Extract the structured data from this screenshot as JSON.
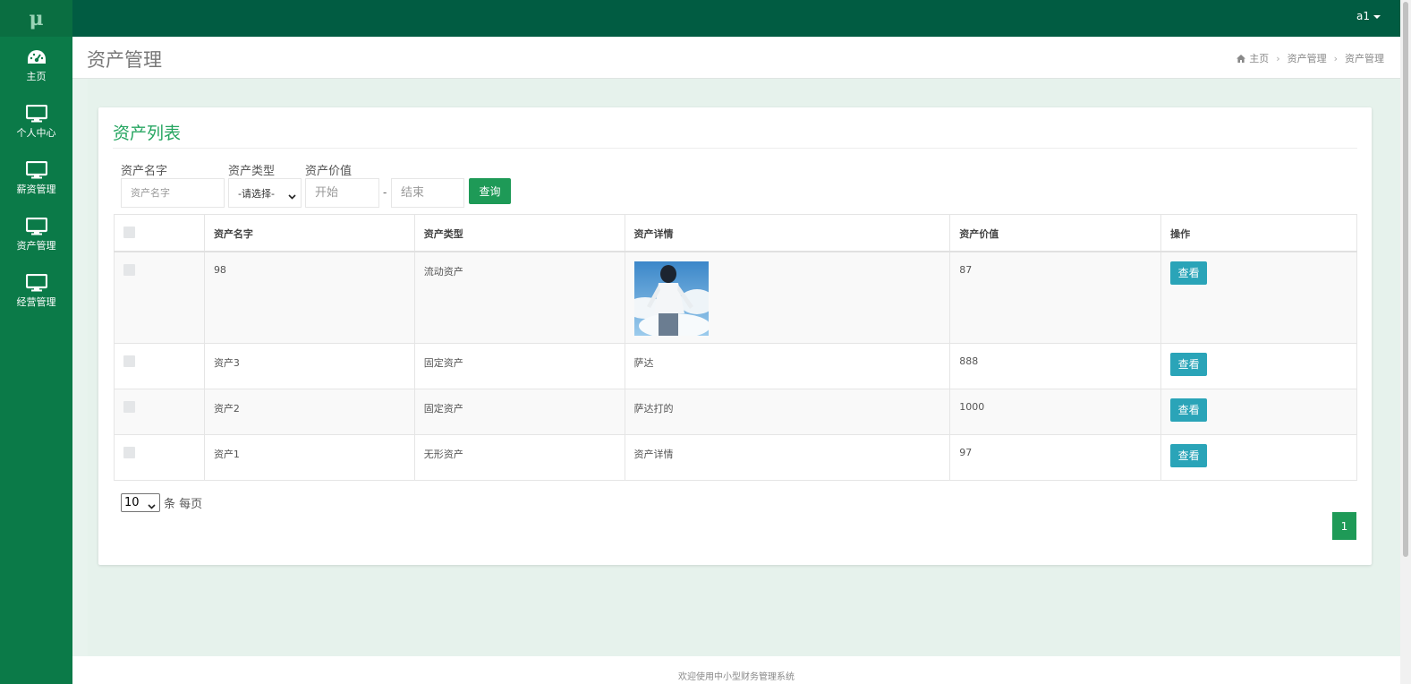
{
  "logo": {
    "text": "μ"
  },
  "sidebar": {
    "items": [
      {
        "label": "主页",
        "icon": "dashboard-icon"
      },
      {
        "label": "个人中心",
        "icon": "monitor-icon"
      },
      {
        "label": "薪资管理",
        "icon": "monitor-icon"
      },
      {
        "label": "资产管理",
        "icon": "monitor-icon"
      },
      {
        "label": "经营管理",
        "icon": "monitor-icon"
      }
    ]
  },
  "topbar": {
    "user": "a1"
  },
  "header": {
    "title": "资产管理",
    "breadcrumb": [
      "主页",
      "资产管理",
      "资产管理"
    ]
  },
  "box": {
    "title": "资产列表",
    "filters": {
      "name_label": "资产名字",
      "name_placeholder": "资产名字",
      "type_label": "资产类型",
      "type_selected": "-请选择-",
      "value_label": "资产价值",
      "start_placeholder": "开始",
      "dash": "-",
      "end_placeholder": "结束",
      "search_button": "查询"
    },
    "table": {
      "headers": [
        "资产名字",
        "资产类型",
        "资产详情",
        "资产价值",
        "操作"
      ],
      "rows": [
        {
          "name": "98",
          "type": "流动资产",
          "detail": "",
          "has_image": true,
          "value": "87",
          "action": "查看"
        },
        {
          "name": "资产3",
          "type": "固定资产",
          "detail": "萨达",
          "has_image": false,
          "value": "888",
          "action": "查看"
        },
        {
          "name": "资产2",
          "type": "固定资产",
          "detail": "萨达打的",
          "has_image": false,
          "value": "1000",
          "action": "查看"
        },
        {
          "name": "资产1",
          "type": "无形资产",
          "detail": "资产详情",
          "has_image": false,
          "value": "97",
          "action": "查看"
        }
      ]
    },
    "paging": {
      "page_size": "10",
      "page_size_suffix": "条 每页",
      "current_page": "1"
    }
  },
  "footer": {
    "text": "欢迎使用中小型财务管理系统"
  },
  "colors": {
    "sidebar": "#0b7a48",
    "topbar": "#015c42",
    "accent": "#1e9a57",
    "view_button": "#2aa4b8"
  }
}
